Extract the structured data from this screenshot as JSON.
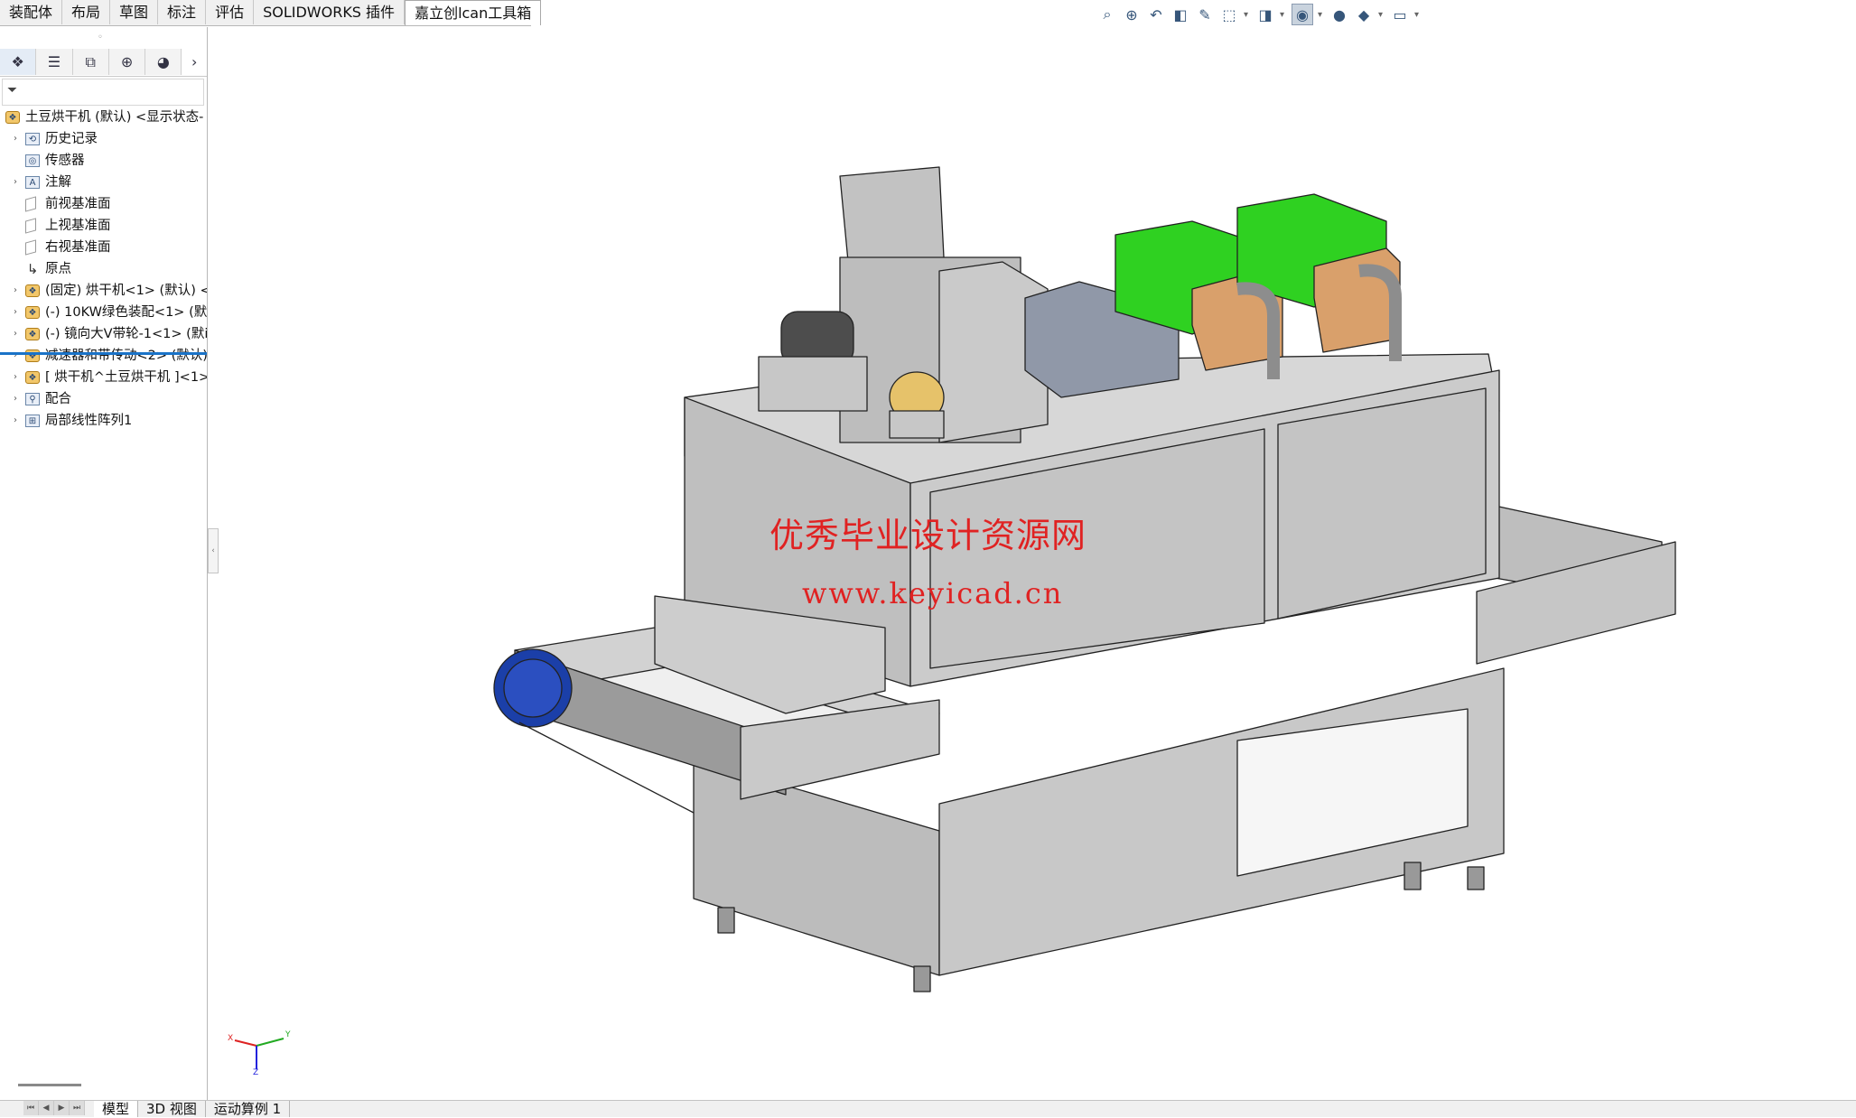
{
  "command_tabs": [
    "装配体",
    "布局",
    "草图",
    "标注",
    "评估",
    "SOLIDWORKS 插件",
    "嘉立创lcan工具箱"
  ],
  "active_command_tab": "嘉立创lcan工具箱",
  "heads_up_icons": [
    "zoom-to-fit-icon",
    "zoom-to-area-icon",
    "previous-view-icon",
    "section-view-icon",
    "dynamic-annotation-icon",
    "view-orientation-icon",
    "display-style-icon",
    "hide-show-icon",
    "edit-appearance-icon",
    "apply-scene-icon",
    "view-settings-icon"
  ],
  "panel_tabs": [
    "featuremanager-icon",
    "propertymanager-icon",
    "configurationmanager-icon",
    "dimxpert-icon",
    "display-manager-icon"
  ],
  "panel_more": "›",
  "filter_icon": "filter-icon",
  "tree": [
    {
      "label": "土豆烘干机 (默认) <显示状态-",
      "icon": "assembly-icon",
      "level": 0,
      "expand": ""
    },
    {
      "label": "历史记录",
      "icon": "history-icon",
      "level": 1,
      "expand": "›"
    },
    {
      "label": "传感器",
      "icon": "sensor-icon",
      "level": 1,
      "expand": ""
    },
    {
      "label": "注解",
      "icon": "annotation-icon",
      "level": 1,
      "expand": "›"
    },
    {
      "label": "前视基准面",
      "icon": "plane-icon",
      "level": 1,
      "expand": ""
    },
    {
      "label": "上视基准面",
      "icon": "plane-icon",
      "level": 1,
      "expand": ""
    },
    {
      "label": "右视基准面",
      "icon": "plane-icon",
      "level": 1,
      "expand": ""
    },
    {
      "label": "原点",
      "icon": "origin-icon",
      "level": 1,
      "expand": ""
    },
    {
      "label": "(固定) 烘干机<1> (默认) <",
      "icon": "part-icon",
      "level": 1,
      "expand": "›"
    },
    {
      "label": "(-) 10KW绿色装配<1> (默",
      "icon": "part-icon",
      "level": 1,
      "expand": "›"
    },
    {
      "label": "(-) 镜向大V带轮-1<1> (默i",
      "icon": "part-icon",
      "level": 1,
      "expand": "›"
    },
    {
      "label": "减速器和带传动<2> (默认)",
      "icon": "part-icon",
      "level": 1,
      "expand": "›"
    },
    {
      "label": "[ 烘干机^土豆烘干机 ]<1>",
      "icon": "part-icon",
      "level": 1,
      "expand": "›"
    },
    {
      "label": "配合",
      "icon": "mates-icon",
      "level": 1,
      "expand": "›"
    },
    {
      "label": "局部线性阵列1",
      "icon": "pattern-icon",
      "level": 1,
      "expand": "›"
    }
  ],
  "bottom_tabs": [
    "模型",
    "3D 视图",
    "运动算例 1"
  ],
  "active_bottom_tab": "模型",
  "watermark_cn": "优秀毕业设计资源网",
  "watermark_url": "www.keyicad.cn",
  "triad": {
    "x": "X",
    "y": "Y",
    "z": "Z"
  },
  "colors": {
    "machine_body": "#c4c4c4",
    "heater_green": "#2fd121",
    "heater_tan": "#d9a06b",
    "belt_wheel": "#1b3fa8",
    "watermark": "#e02222",
    "tree_separator": "#1a73c8"
  }
}
